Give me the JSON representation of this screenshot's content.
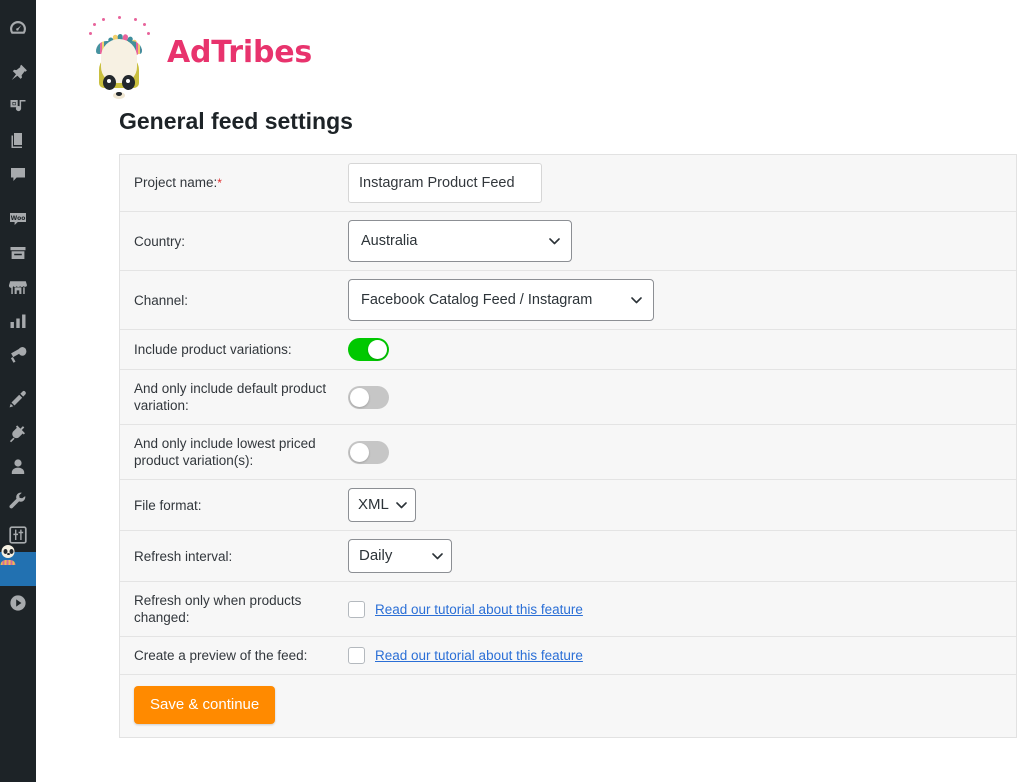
{
  "sidebar": {
    "items": [
      {
        "name": "dashboard",
        "icon": "dashboard-icon",
        "active": false
      },
      {
        "name": "posts",
        "icon": "pin-icon",
        "active": false
      },
      {
        "name": "media",
        "icon": "media-icon",
        "active": false
      },
      {
        "name": "pages",
        "icon": "pages-icon",
        "active": false
      },
      {
        "name": "comments",
        "icon": "comment-icon",
        "active": false
      },
      {
        "name": "woocommerce",
        "icon": "woo-icon",
        "active": false
      },
      {
        "name": "products",
        "icon": "products-box-icon",
        "active": false
      },
      {
        "name": "store",
        "icon": "storefront-icon",
        "active": false
      },
      {
        "name": "analytics",
        "icon": "bar-chart-icon",
        "active": false
      },
      {
        "name": "marketing",
        "icon": "megaphone-icon",
        "active": false
      },
      {
        "name": "appearance",
        "icon": "paintbrush-icon",
        "active": false
      },
      {
        "name": "plugins",
        "icon": "plug-icon",
        "active": false
      },
      {
        "name": "users",
        "icon": "user-icon",
        "active": false
      },
      {
        "name": "tools",
        "icon": "wrench-icon",
        "active": false
      },
      {
        "name": "settings",
        "icon": "sliders-icon",
        "active": false
      },
      {
        "name": "adtribes",
        "icon": "panda-icon",
        "active": true
      },
      {
        "name": "video",
        "icon": "play-circle-icon",
        "active": false
      }
    ],
    "active_color": "#2271b1",
    "background_color": "#1d2327"
  },
  "brand": {
    "name": "AdTribes",
    "color": "#e8336d",
    "logo_icon": "adtribes-panda-logo"
  },
  "page": {
    "title": "General feed settings"
  },
  "form": {
    "rows": {
      "project_name": {
        "label": "Project name:",
        "required_marker": "*",
        "value": "Instagram Product Feed"
      },
      "country": {
        "label": "Country:",
        "value": "Australia"
      },
      "channel": {
        "label": "Channel:",
        "value": "Facebook Catalog Feed / Instagram"
      },
      "include_variations": {
        "label": "Include product variations:",
        "state": "on"
      },
      "default_variation": {
        "label": "And only include default product variation:",
        "state": "off"
      },
      "lowest_priced_variation": {
        "label": "And only include lowest priced product variation(s):",
        "state": "off"
      },
      "file_format": {
        "label": "File format:",
        "value": "XML"
      },
      "refresh_interval": {
        "label": "Refresh interval:",
        "value": "Daily"
      },
      "refresh_on_change": {
        "label": "Refresh only when products changed:",
        "checked": false,
        "link_text": "Read our tutorial about this feature"
      },
      "create_preview": {
        "label": "Create a preview of the feed:",
        "checked": false,
        "link_text": "Read our tutorial about this feature"
      }
    },
    "save_button": "Save & continue",
    "save_button_color": "#ff8a00",
    "toggle_on_color": "#00c800",
    "toggle_off_color": "#c6c6c6",
    "link_color": "#2b6fd6"
  }
}
